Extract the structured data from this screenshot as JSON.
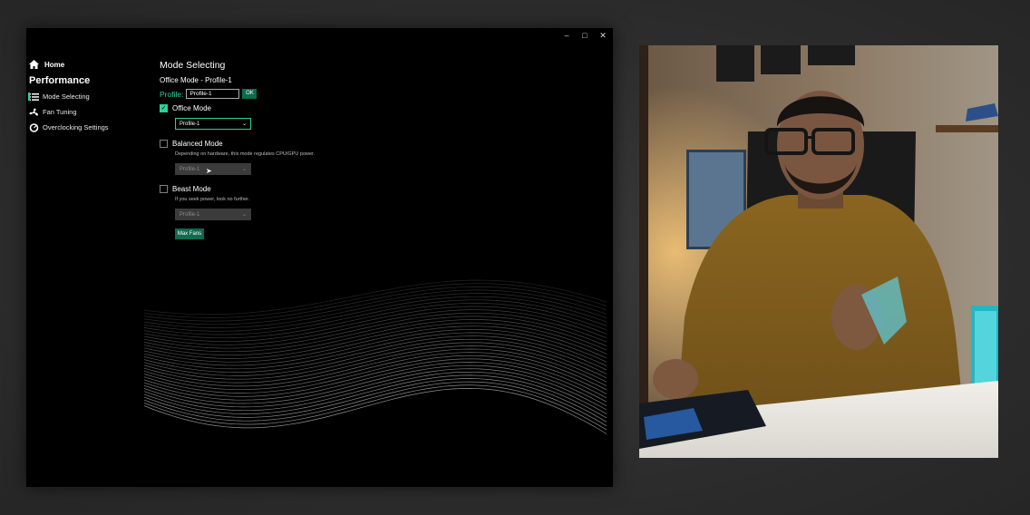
{
  "window_controls": {
    "minimize": "–",
    "maximize": "□",
    "close": "✕"
  },
  "sidebar": {
    "home": {
      "label": "Home",
      "icon": "home-icon"
    },
    "section": "Performance",
    "items": [
      {
        "label": "Mode Selecting",
        "icon": "list-icon",
        "active": true
      },
      {
        "label": "Fan Tuning",
        "icon": "fan-icon",
        "active": false
      },
      {
        "label": "Overclocking Settings",
        "icon": "gauge-icon",
        "active": false
      }
    ]
  },
  "main": {
    "title": "Mode Selecting",
    "subtitle": "Office Mode - Profile-1",
    "profile_label": "Profile:",
    "profile_value": "Profile-1",
    "ok_label": "OK",
    "modes": [
      {
        "label": "Office Mode",
        "checked": true,
        "description": "",
        "select_value": "Profile-1",
        "enabled": true
      },
      {
        "label": "Balanced Mode",
        "checked": false,
        "description": "Depending on hardware, this mode regulates CPU/GPU power.",
        "select_value": "Profile-1",
        "enabled": false
      },
      {
        "label": "Beast Mode",
        "checked": false,
        "description": "If you seek power, look no further.",
        "select_value": "Profile-1",
        "enabled": false
      }
    ],
    "max_fans_label": "Max Fans"
  },
  "colors": {
    "accent": "#2bd09b",
    "button_bg": "#0f6a4e",
    "window_bg": "#000000",
    "stage_bg": "#2e2e2e"
  }
}
